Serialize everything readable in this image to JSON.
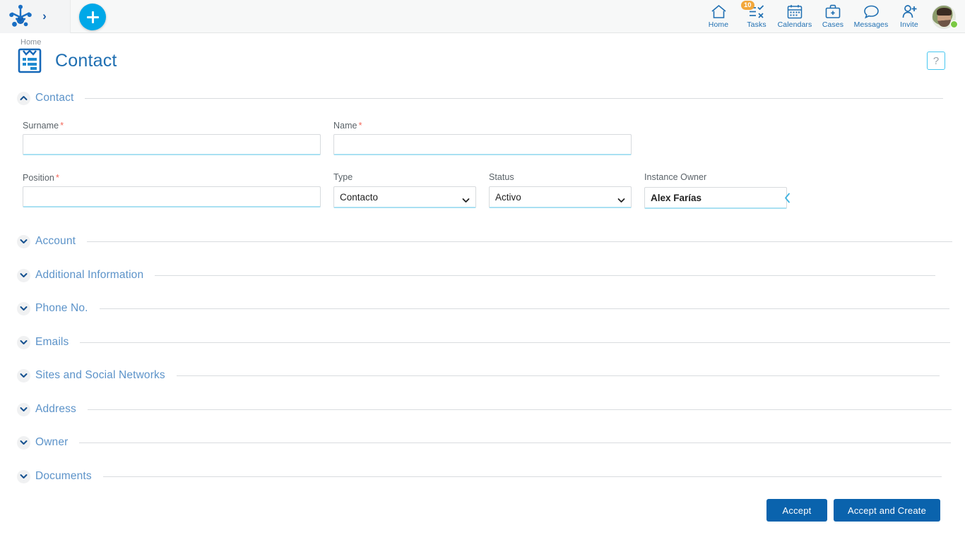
{
  "topbar": {
    "logo_icon": "frog-foot-logo-icon",
    "expand_icon": "chevron-right-icon",
    "add_button_label": "+",
    "nav": [
      {
        "label": "Home",
        "icon": "home-icon",
        "badge": null
      },
      {
        "label": "Tasks",
        "icon": "tasks-checklist-icon",
        "badge": "10"
      },
      {
        "label": "Calendars",
        "icon": "calendar-icon",
        "badge": null
      },
      {
        "label": "Cases",
        "icon": "briefcase-icon",
        "badge": null
      },
      {
        "label": "Messages",
        "icon": "speech-bubble-icon",
        "badge": null
      },
      {
        "label": "Invite",
        "icon": "user-add-icon",
        "badge": null
      }
    ],
    "avatar_name": "user-avatar",
    "status": "online"
  },
  "header": {
    "breadcrumb": "Home",
    "title": "Contact",
    "icon": "contact-card-icon",
    "help_label": "?"
  },
  "sections": [
    {
      "title": "Contact",
      "expanded": true
    },
    {
      "title": "Account",
      "expanded": false
    },
    {
      "title": "Additional Information",
      "expanded": false
    },
    {
      "title": "Phone No.",
      "expanded": false
    },
    {
      "title": "Emails",
      "expanded": false
    },
    {
      "title": "Sites and Social Networks",
      "expanded": false
    },
    {
      "title": "Address",
      "expanded": false
    },
    {
      "title": "Owner",
      "expanded": false
    },
    {
      "title": "Documents",
      "expanded": false
    }
  ],
  "form": {
    "surname": {
      "label": "Surname",
      "required": true,
      "value": "",
      "placeholder": ""
    },
    "name": {
      "label": "Name",
      "required": true,
      "value": "",
      "placeholder": ""
    },
    "position": {
      "label": "Position",
      "required": true,
      "value": "",
      "placeholder": ""
    },
    "type": {
      "label": "Type",
      "required": false,
      "value": "Contacto",
      "options": [
        "Contacto"
      ]
    },
    "status": {
      "label": "Status",
      "required": false,
      "value": "Activo",
      "options": [
        "Activo"
      ]
    },
    "instance_owner": {
      "label": "Instance Owner",
      "required": false,
      "value": "Alex Farías"
    }
  },
  "footer": {
    "accept_label": "Accept",
    "accept_and_create_label": "Accept and Create"
  },
  "colors": {
    "accent_blue": "#1f6fb2",
    "button_blue": "#0a63ad",
    "cyan": "#00a8e8",
    "badge_orange": "#f2a73b",
    "required_red": "#f4685b",
    "section_blue": "#5c93c9",
    "status_green": "#7ac943"
  }
}
